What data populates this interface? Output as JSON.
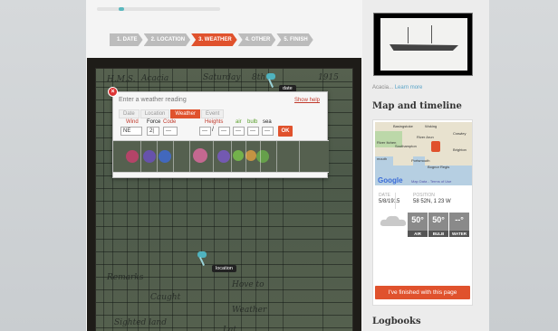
{
  "steps": [
    {
      "label": "1. DATE"
    },
    {
      "label": "2. LOCATION"
    },
    {
      "label": "3. WEATHER"
    },
    {
      "label": "4. OTHER"
    },
    {
      "label": "5. FINISH"
    }
  ],
  "pins": {
    "date_label": "date",
    "location_label": "location"
  },
  "dialog": {
    "title": "Enter a weather reading",
    "help": "Show help",
    "tabs": [
      "Date",
      "Location",
      "Weather",
      "Event"
    ],
    "labels": {
      "wind": "Wind",
      "force": "Force",
      "code": "Code",
      "heights": "Heights",
      "air": "air",
      "bulb": "bulb",
      "sea": "sea"
    },
    "values": {
      "wind": "NE",
      "force": "2|",
      "code": "---",
      "height1": "---",
      "height2": "---",
      "air": "---",
      "bulb": "---",
      "sea": "---"
    },
    "slash": "/",
    "ok": "OK"
  },
  "sidebar": {
    "caption": "Acacia...",
    "learn_more": "Learn more",
    "map_title": "Map and timeline",
    "map": {
      "provider": "Google",
      "terms": "Map Data - Terms of Use",
      "places": [
        "Basingstoke",
        "Woking",
        "Crawley",
        "River Arun",
        "River Itchen",
        "Southampton",
        "Brighton",
        "mouth",
        "Portsmouth",
        "Bognor Regis"
      ]
    },
    "date_label": "DATE",
    "date_value": "5/8/1915",
    "position_label": "POSITION",
    "position_value": "58 52N, 1 23 W",
    "weather": [
      {
        "value": "50°",
        "label": "AIR"
      },
      {
        "value": "50°",
        "label": "BULB"
      },
      {
        "value": "--°",
        "label": "WATER"
      }
    ],
    "finished_button": "I've finished with this page",
    "logbooks_title": "Logbooks"
  }
}
